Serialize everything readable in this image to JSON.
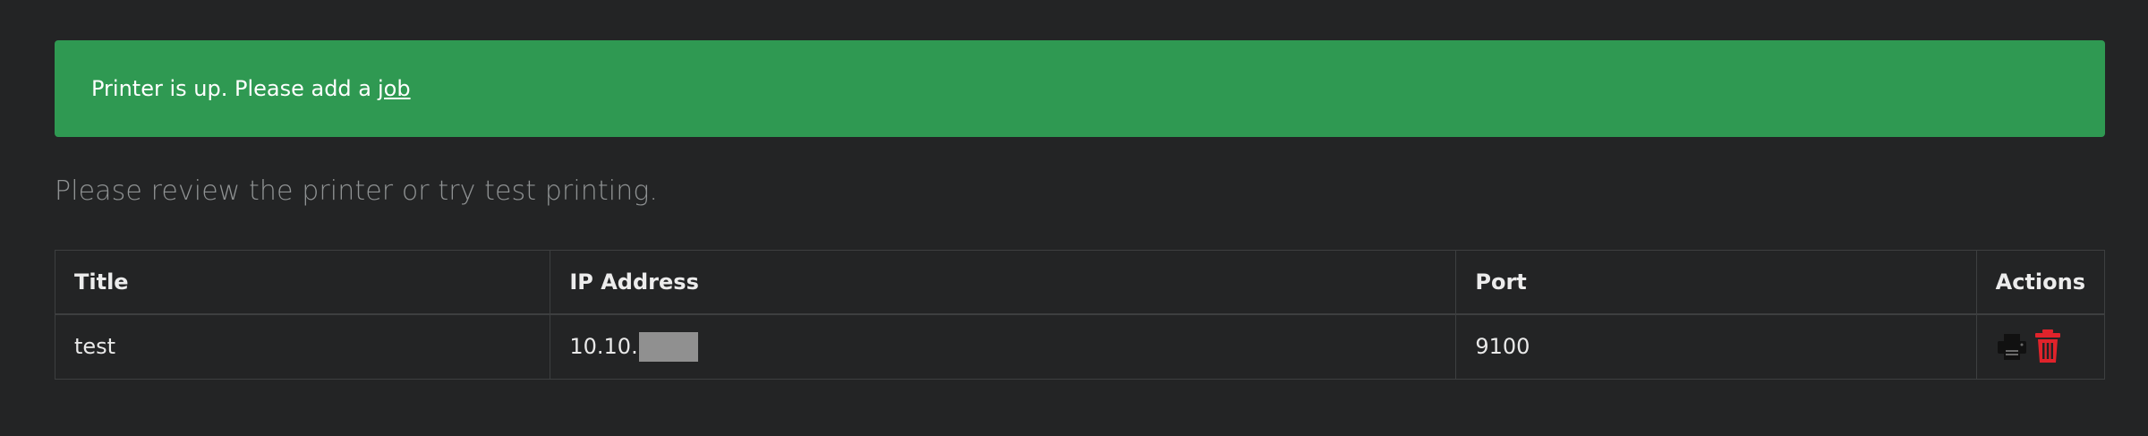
{
  "alert": {
    "text": "Printer is up. Please add a",
    "link_text": "job",
    "color": "#2f9952"
  },
  "lead": "Please review the printer or try test printing.",
  "table": {
    "headers": {
      "title": "Title",
      "ip": "IP Address",
      "port": "Port",
      "actions": "Actions"
    },
    "rows": [
      {
        "title": "test",
        "ip_prefix": "10.10.",
        "port": "9100",
        "actions": [
          "print-icon",
          "trash-icon"
        ]
      }
    ]
  },
  "colors": {
    "background": "#232425",
    "delete": "#e0232b"
  }
}
